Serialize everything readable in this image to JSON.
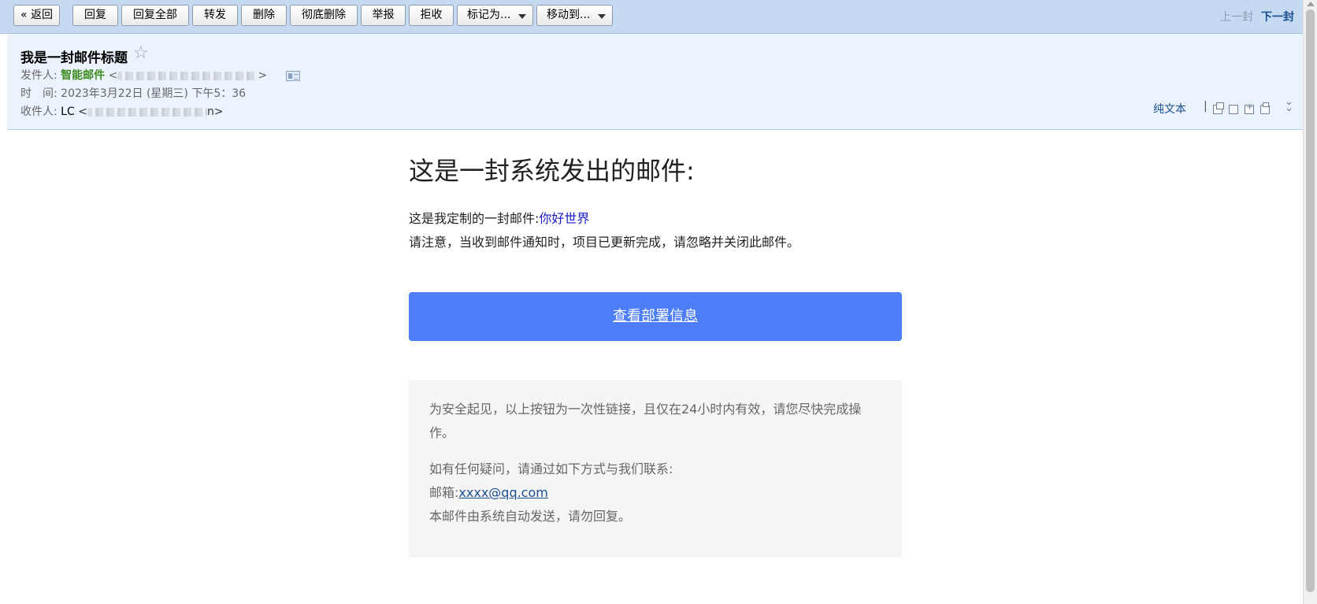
{
  "toolbar": {
    "back": "« 返回",
    "reply": "回复",
    "reply_all": "回复全部",
    "forward": "转发",
    "delete": "删除",
    "delete_permanent": "彻底删除",
    "report": "举报",
    "reject": "拒收",
    "mark_as": "标记为...",
    "move_to": "移动到...",
    "prev": "上一封",
    "next": "下一封"
  },
  "header": {
    "subject": "我是一封邮件标题",
    "star": "☆",
    "from_label": "发件人:",
    "from_name": "智能邮件",
    "time_label": "时　间:",
    "time_value": "2023年3月22日 (星期三) 下午5：36",
    "to_label": "收件人:",
    "to_name": "LC",
    "to_suffix": "n>",
    "plain_text": "纯文本",
    "separator": "|",
    "expand_icon": "chevron-double-down-icon"
  },
  "email": {
    "title": "这是一封系统发出的邮件:",
    "custom_prefix": "这是我定制的一封邮件:",
    "custom_highlight": "你好世界",
    "notice_line": "请注意，当收到邮件通知时，项目已更新完成，请忽略并关闭此邮件。",
    "cta_label": "查看部署信息",
    "cta_color": "#4d7ef7",
    "security_note": "为安全起见，以上按钮为一次性链接，且仅在24小时内有效，请您尽快完成操作。",
    "contact_intro": "如有任何疑问，请通过如下方式与我们联系:",
    "mailbox_label": "邮箱:",
    "mailbox_email": "xxxx@qq.com",
    "auto_note": "本邮件由系统自动发送，请勿回复。"
  }
}
